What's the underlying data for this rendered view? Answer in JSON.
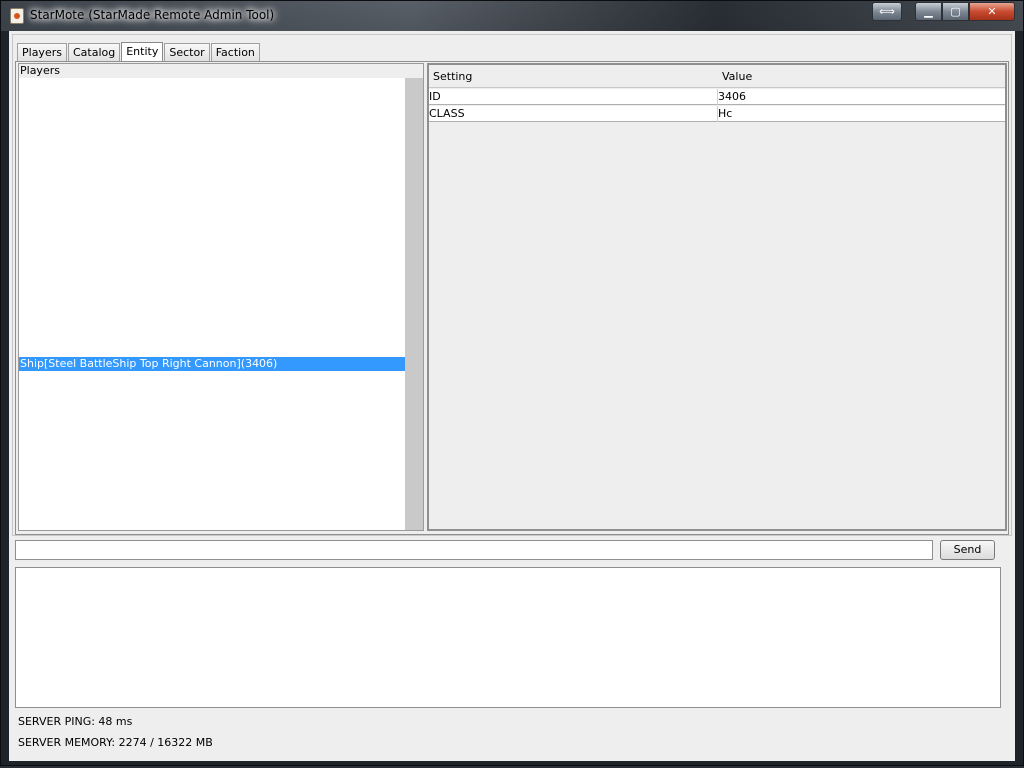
{
  "window": {
    "title": "StarMote (StarMade Remote Admin Tool)",
    "controls": {
      "resize": "⟺",
      "minimize": "▁",
      "maximize": "▢",
      "close": "✕"
    }
  },
  "tabs": [
    {
      "label": "Players",
      "active": false
    },
    {
      "label": "Catalog",
      "active": false
    },
    {
      "label": "Entity",
      "active": true
    },
    {
      "label": "Sector",
      "active": false
    },
    {
      "label": "Faction",
      "active": false
    }
  ],
  "entity_list": {
    "header": "Players",
    "items": [
      {
        "label": "Ship[Steel BattleShip Top Right Cannon](3406)",
        "selected": true
      }
    ]
  },
  "properties": {
    "columns": [
      "Setting",
      "Value"
    ],
    "rows": [
      {
        "setting": "ID",
        "value": "3406"
      },
      {
        "setting": "CLASS",
        "value": "Hc"
      }
    ]
  },
  "command": {
    "input_value": "",
    "send_label": "Send"
  },
  "log": {
    "text": ""
  },
  "status": {
    "ping": "SERVER PING: 48 ms",
    "memory": "SERVER MEMORY: 2274 / 16322 MB"
  },
  "colors": {
    "selection": "#3399ff",
    "panel_bg": "#eeeeee",
    "close_button": "#c94b30"
  }
}
